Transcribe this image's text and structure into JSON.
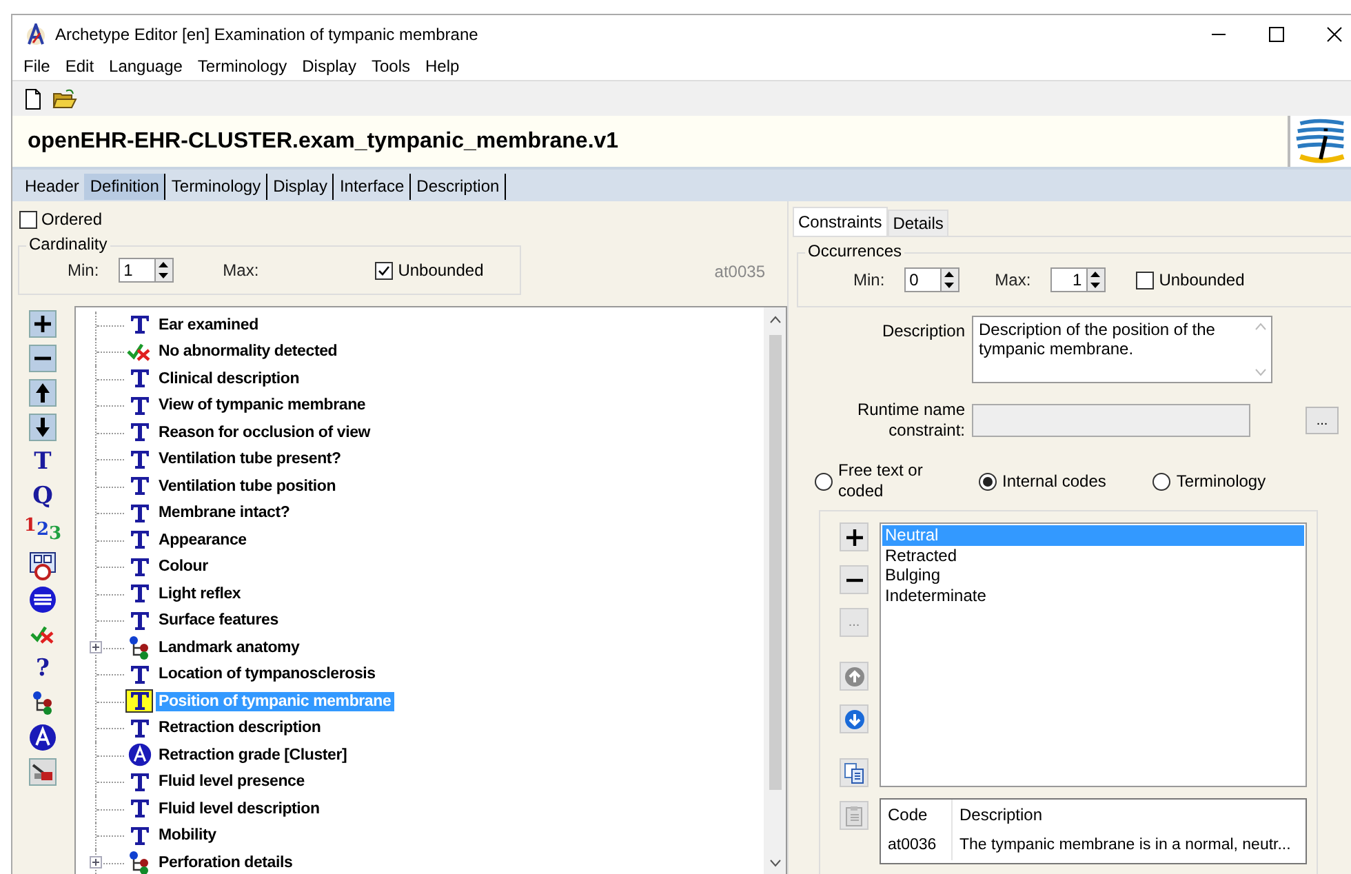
{
  "window": {
    "title": "Archetype Editor [en] Examination of tympanic membrane"
  },
  "menu": [
    "File",
    "Edit",
    "Language",
    "Terminology",
    "Display",
    "Tools",
    "Help"
  ],
  "toolbar": [
    {
      "kind": "new"
    },
    {
      "kind": "open"
    }
  ],
  "archetype_id": "openEHR-EHR-CLUSTER.exam_tympanic_membrane.v1",
  "tabs": [
    {
      "label": "Header",
      "selected": false
    },
    {
      "label": "Definition",
      "selected": true
    },
    {
      "label": "Terminology",
      "selected": false
    },
    {
      "label": "Display",
      "selected": false
    },
    {
      "label": "Interface",
      "selected": false
    },
    {
      "label": "Description",
      "selected": false
    }
  ],
  "definition": {
    "ordered": {
      "label": "Ordered",
      "checked": false
    },
    "cardinality": {
      "title": "Cardinality",
      "min_label": "Min:",
      "min": "1",
      "max_label": "Max:",
      "unbounded": {
        "label": "Unbounded",
        "checked": true
      }
    },
    "node_code": "at0035",
    "palette": [
      {
        "kind": "add"
      },
      {
        "kind": "remove"
      },
      {
        "kind": "up"
      },
      {
        "kind": "down"
      },
      {
        "kind": "glyph",
        "text": "T"
      },
      {
        "kind": "glyph",
        "text": "Q"
      },
      {
        "kind": "count",
        "text": "123"
      },
      {
        "kind": "datetime"
      },
      {
        "kind": "ordinal"
      },
      {
        "kind": "boolean"
      },
      {
        "kind": "glyph",
        "text": "?"
      },
      {
        "kind": "cluster"
      },
      {
        "kind": "choice"
      },
      {
        "kind": "slot"
      }
    ],
    "tree": [
      {
        "label": "Ear examined",
        "kind": "text",
        "selected": false
      },
      {
        "label": "No abnormality detected",
        "kind": "boolean",
        "selected": false
      },
      {
        "label": "Clinical description",
        "kind": "text",
        "selected": false
      },
      {
        "label": "View of tympanic membrane",
        "kind": "text",
        "selected": false
      },
      {
        "label": "Reason for occlusion of view",
        "kind": "text",
        "selected": false
      },
      {
        "label": "Ventilation tube present?",
        "kind": "text",
        "selected": false
      },
      {
        "label": "Ventilation tube position",
        "kind": "text",
        "selected": false
      },
      {
        "label": "Membrane intact?",
        "kind": "text",
        "selected": false
      },
      {
        "label": "Appearance",
        "kind": "text",
        "selected": false
      },
      {
        "label": "Colour",
        "kind": "text",
        "selected": false
      },
      {
        "label": "Light reflex",
        "kind": "text",
        "selected": false
      },
      {
        "label": "Surface features",
        "kind": "text",
        "selected": false
      },
      {
        "label": "Landmark anatomy",
        "kind": "cluster",
        "expanded": false,
        "selected": false
      },
      {
        "label": "Location of tympanosclerosis",
        "kind": "text",
        "selected": false
      },
      {
        "label": "Position of tympanic membrane",
        "kind": "text",
        "selected": true
      },
      {
        "label": "Retraction description",
        "kind": "text",
        "selected": false
      },
      {
        "label": "Retraction grade [Cluster]",
        "kind": "choice",
        "selected": false
      },
      {
        "label": "Fluid level presence",
        "kind": "text",
        "selected": false
      },
      {
        "label": "Fluid level description",
        "kind": "text",
        "selected": false
      },
      {
        "label": "Mobility",
        "kind": "text",
        "selected": false
      },
      {
        "label": "Perforation details",
        "kind": "cluster",
        "expanded": false,
        "selected": false
      }
    ]
  },
  "constraints": {
    "tabs": [
      {
        "label": "Constraints",
        "selected": true
      },
      {
        "label": "Details",
        "selected": false
      }
    ],
    "occurrences": {
      "title": "Occurrences",
      "min_label": "Min:",
      "min": "0",
      "max_label": "Max:",
      "max": "1",
      "unbounded": {
        "label": "Unbounded",
        "checked": false
      }
    },
    "description_label": "Description",
    "description": "Description of the position of the tympanic membrane.",
    "runtime_label": "Runtime name constraint:",
    "browse_button": "...",
    "options": [
      {
        "label": "Free text or coded",
        "selected": false
      },
      {
        "label": "Internal codes",
        "selected": true
      },
      {
        "label": "Terminology",
        "selected": false
      }
    ],
    "list_buttons": [
      {
        "kind": "add",
        "disabled": false
      },
      {
        "kind": "remove",
        "disabled": false
      },
      {
        "kind": "more",
        "text": "...",
        "disabled": true
      },
      {
        "kind": "up",
        "disabled": true
      },
      {
        "kind": "down",
        "disabled": false
      },
      {
        "kind": "copy",
        "disabled": false
      },
      {
        "kind": "paste",
        "disabled": true
      }
    ],
    "codes": [
      {
        "label": "Neutral",
        "selected": true
      },
      {
        "label": "Retracted",
        "selected": false
      },
      {
        "label": "Bulging",
        "selected": false
      },
      {
        "label": "Indeterminate",
        "selected": false
      }
    ],
    "table": {
      "columns": [
        "Code",
        "Description"
      ],
      "rows": [
        [
          "at0036",
          "The tympanic membrane is in a normal, neutr..."
        ]
      ]
    }
  }
}
